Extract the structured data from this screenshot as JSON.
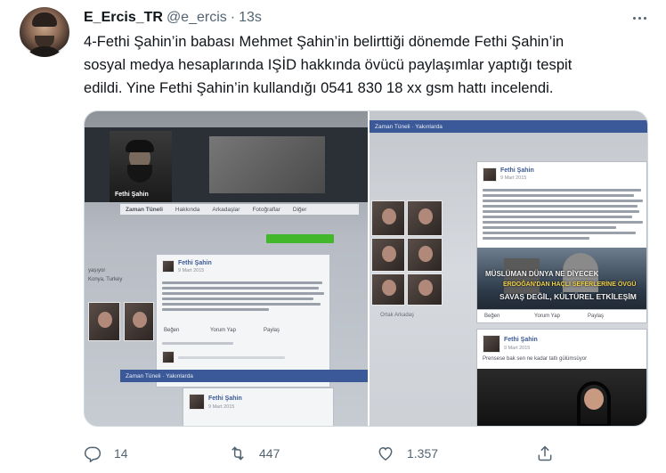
{
  "author": {
    "name": "E_Ercis_TR",
    "handle": "@e_ercis",
    "separator": "·",
    "time": "13s"
  },
  "tweet": {
    "lines": [
      "4-Fethi Şahin’in babası Mehmet Şahin’in belirttiği dönemde Fethi Şahin’in",
      "sosyal medya hesaplarında IŞİD hakkında övücü paylaşımlar yaptığı tespit",
      "edildi. Yine Fethi Şahin’in kullandığı 0541 830 18 xx gsm hattı incelendi."
    ]
  },
  "media": {
    "left": {
      "bar_items": [
        "Zaman Tüneli",
        "Hakkında",
        "Arkadaşlar",
        "Fotoğraflar",
        "Diğer"
      ],
      "post_name": "Fethi Şahin",
      "post_date": "9 Mart 2015",
      "like": "Beğen",
      "comment": "Yorum Yap",
      "share": "Paylaş",
      "bottom_bar": "Zaman Tüneli · Yakınlarda",
      "bottom_name": "Fethi Şahin",
      "bottom_date": "9 Mart 2015",
      "side_info": [
        "yaşıyor",
        "Konya, Turkey"
      ]
    },
    "right": {
      "bar": "Zaman Tüneli · Yakınlarda",
      "post_name": "Fethi Şahin",
      "post_date": "9 Mart 2015",
      "friends": "Ortak Arkadaş",
      "banner_line1": "MÜSLÜMAN DÜNYA NE DİYECEK",
      "banner_line2": "ERDOĞAN'DAN HAÇLI SEFERLERİNE ÖVGÜ",
      "banner_line3": "SAVAŞ DEĞİL, KÜLTÜREL ETKİLEŞİM",
      "like": "Beğen",
      "comment": "Yorum Yap",
      "share": "Paylaş",
      "post2_name": "Fethi Şahin",
      "post2_date": "9 Mart 2015",
      "post2_text": "Prensese bak sen ne kadar tatlı gülümsüyor"
    }
  },
  "actions": {
    "reply_count": "14",
    "retweet_count": "447",
    "like_count": "1.357",
    "icons": [
      "reply-icon",
      "retweet-icon",
      "like-icon",
      "share-icon"
    ]
  }
}
